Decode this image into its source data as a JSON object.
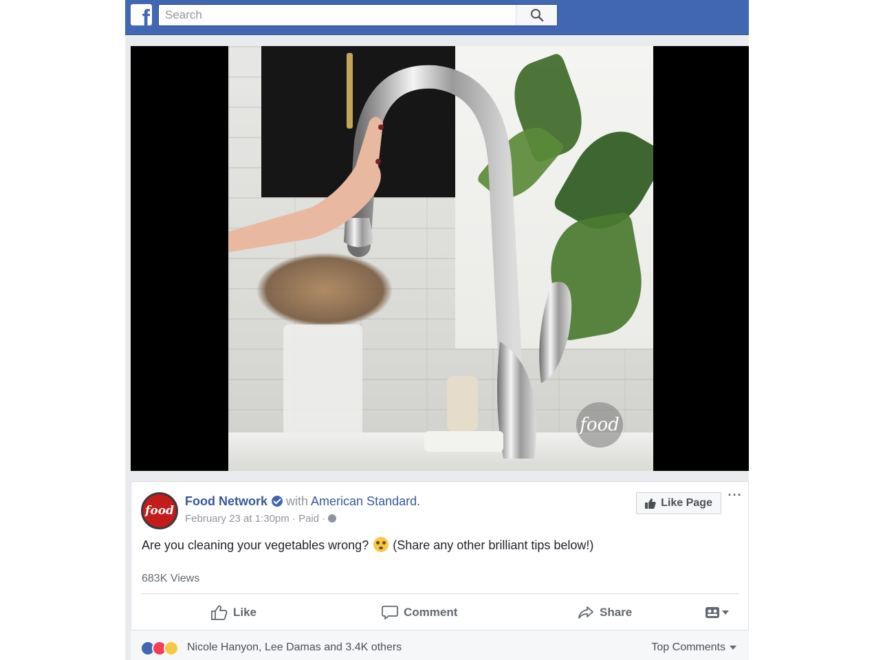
{
  "header": {
    "logo": "f",
    "search_placeholder": "Search"
  },
  "video": {
    "watermark": "food"
  },
  "post": {
    "avatar_text": "food",
    "page_name": "Food Network",
    "with_text": "with",
    "partner_name": "American Standard.",
    "meta": "February 23 at 1:30pm · Paid ·",
    "like_page_label": "Like Page",
    "more_label": "···",
    "text_before_emoji": "Are you cleaning your vegetables wrong?",
    "text_after_emoji": "(Share any other brilliant tips below!)",
    "views": "683K Views",
    "actions": {
      "like": "Like",
      "comment": "Comment",
      "share": "Share"
    },
    "reactions": {
      "names": "Nicole Hanyon, Lee Damas and 3.4K others",
      "icons": [
        "like-icon",
        "love-icon",
        "wow-icon"
      ]
    },
    "comments_order": "Top Comments"
  },
  "colors": {
    "facebook_blue": "#4267b2",
    "link_blue": "#365899",
    "background_gray": "#e9ebee"
  }
}
